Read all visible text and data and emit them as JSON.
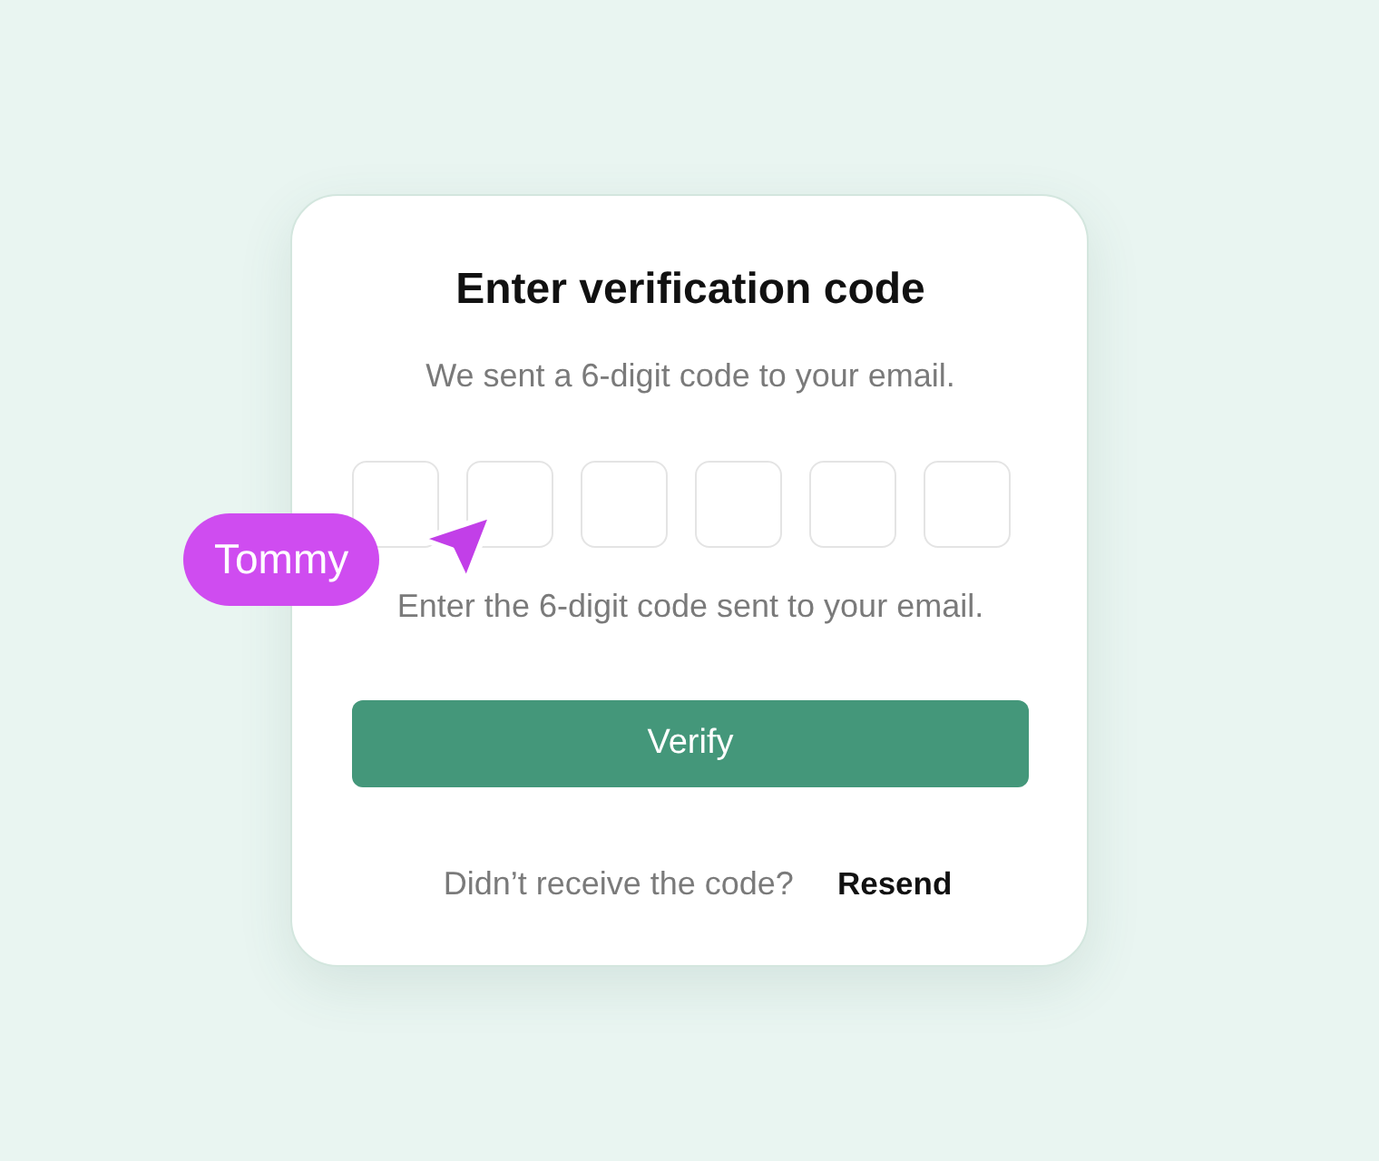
{
  "card": {
    "title": "Enter verification code",
    "subtitle": "We sent a 6-digit code to your email.",
    "code_fields": [
      {
        "focused": false
      },
      {
        "focused": false
      },
      {
        "focused": false
      },
      {
        "focused": false
      },
      {
        "focused": false
      },
      {
        "focused": false
      }
    ],
    "helper": "Enter the 6-digit code sent to your email.",
    "button": {
      "label": "Verify"
    },
    "footer": {
      "prompt": "Didn’t receive the code?",
      "link": "Resend"
    }
  },
  "cursor": {
    "name": "Tommy"
  }
}
